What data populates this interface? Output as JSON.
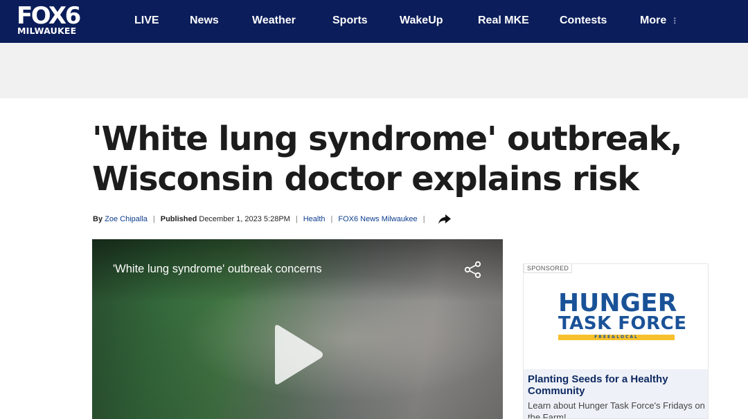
{
  "logo": {
    "main": "FOX6",
    "sub": "MILWAUKEE"
  },
  "nav": {
    "items": [
      {
        "label": "LIVE"
      },
      {
        "label": "News"
      },
      {
        "label": "Weather"
      },
      {
        "label": "Sports"
      },
      {
        "label": "WakeUp"
      },
      {
        "label": "Real MKE"
      },
      {
        "label": "Contests"
      },
      {
        "label": "More"
      }
    ]
  },
  "article": {
    "headline_line1": "'White lung syndrome' outbreak,",
    "headline_line2": "Wisconsin doctor explains risk",
    "byline": {
      "by_label": "By",
      "author": "Zoe Chipalla",
      "published_label": "Published",
      "published_date": "December 1, 2023 5:28PM",
      "category": "Health",
      "source": "FOX6 News Milwaukee"
    }
  },
  "video": {
    "title": "'White lung syndrome' outbreak concerns"
  },
  "sponsored": {
    "label": "SPONSORED",
    "brand_line1": "HUNGER",
    "brand_line2": "TASK FORCE",
    "brand_tagline": "FREE&LOCAL",
    "headline": "Planting Seeds for a Healthy Community",
    "description": "Learn about Hunger Task Force's Fridays on the Farm!"
  },
  "colors": {
    "nav_bg": "#0b1d5a",
    "link": "#0c3d8e",
    "brand_blue": "#1a5298",
    "brand_yellow": "#f6c12c"
  }
}
